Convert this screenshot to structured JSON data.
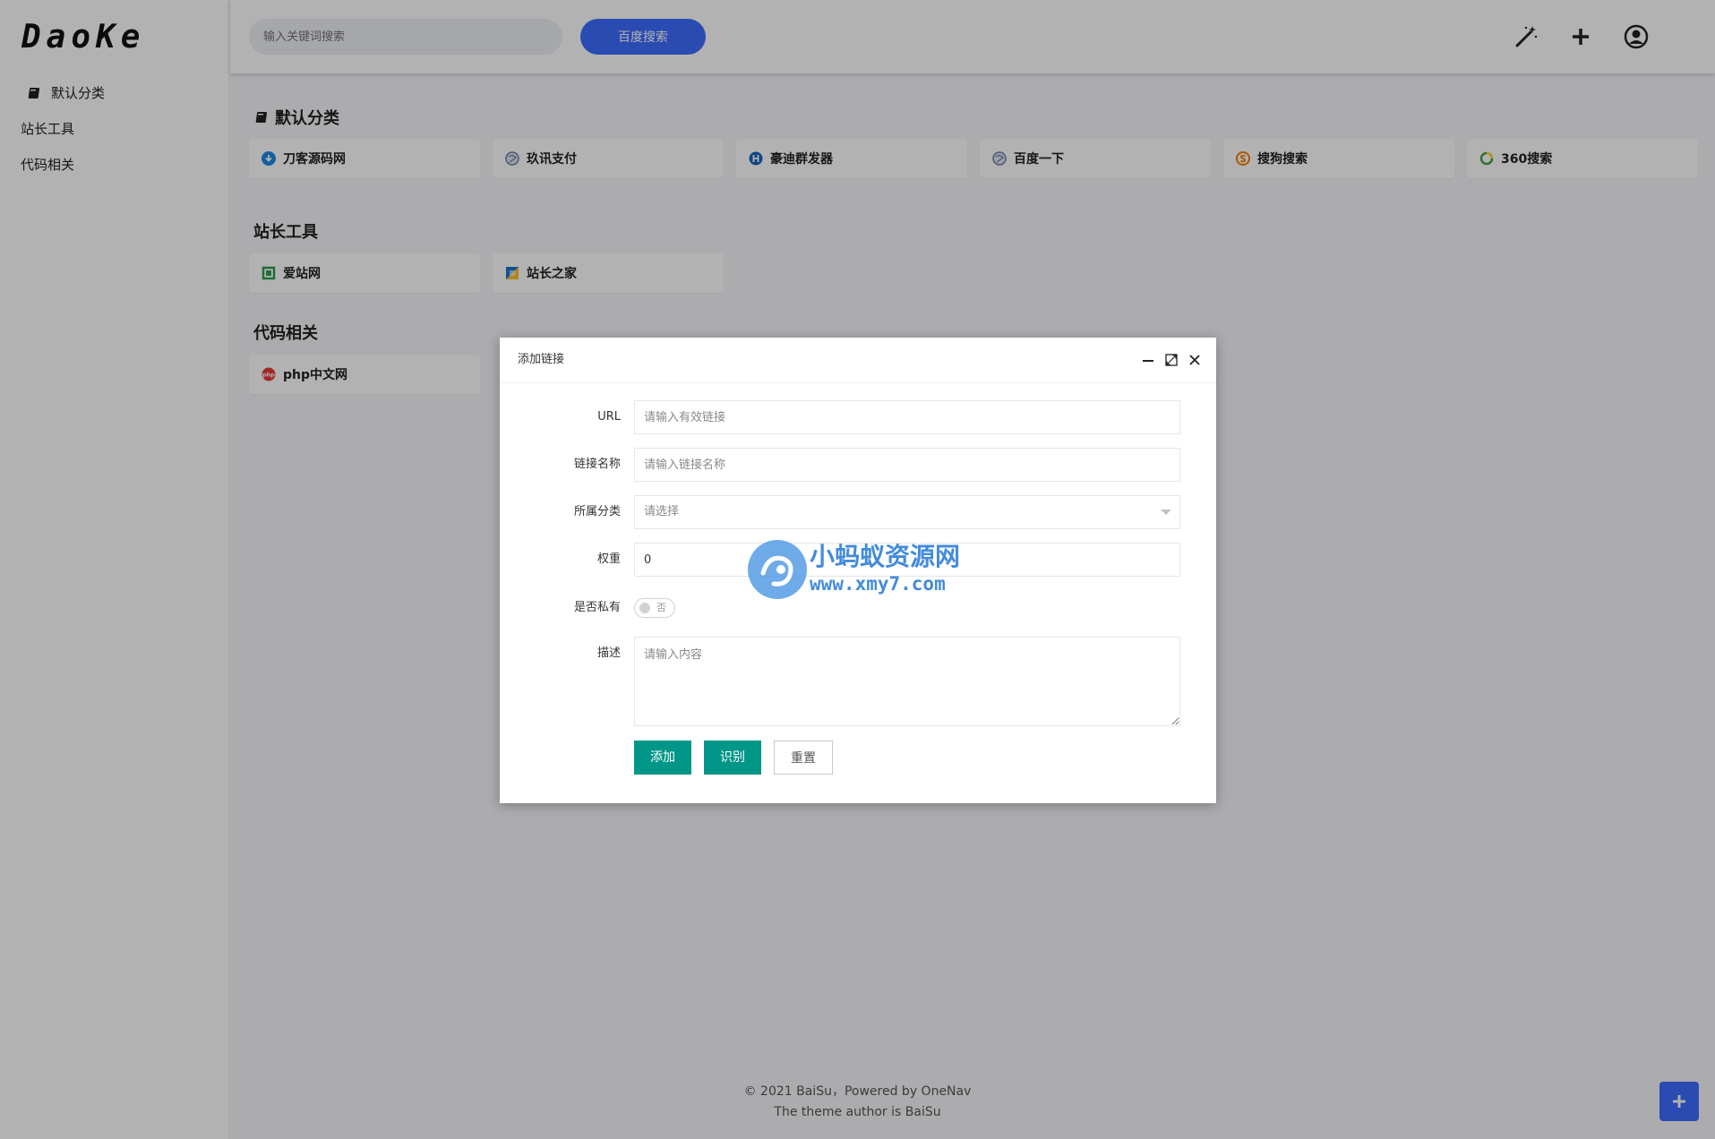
{
  "sidebar": {
    "logo": "DaoKe",
    "items": [
      {
        "label": "默认分类",
        "icon": "book-icon"
      },
      {
        "label": "站长工具"
      },
      {
        "label": "代码相关"
      }
    ]
  },
  "header": {
    "search_placeholder": "输入关键词搜索",
    "search_button": "百度搜索",
    "icons": [
      "magic-wand-icon",
      "plus-icon",
      "user-circle-icon"
    ]
  },
  "categories": [
    {
      "title": "默认分类",
      "links": [
        {
          "label": "刀客源码网",
          "icon": "cloud-download-icon",
          "color": "#1e88e5"
        },
        {
          "label": "玖讯支付",
          "icon": "globe-icon",
          "color": "#6b7fa8"
        },
        {
          "label": "豪迪群发器",
          "icon": "h-badge-icon",
          "color": "#1565c0"
        },
        {
          "label": "百度一下",
          "icon": "globe-icon",
          "color": "#6b7fa8"
        },
        {
          "label": "搜狗搜索",
          "icon": "sogou-icon",
          "color": "#f57c00"
        },
        {
          "label": "360搜索",
          "icon": "360-icon",
          "color": "#43a047"
        }
      ]
    },
    {
      "title": "站长工具",
      "links": [
        {
          "label": "爱站网",
          "icon": "aizhan-icon",
          "color": "#2e9e4f"
        },
        {
          "label": "站长之家",
          "icon": "chinaz-icon",
          "color": "#1976d2"
        }
      ]
    },
    {
      "title": "代码相关",
      "links": [
        {
          "label": "php中文网",
          "icon": "php-icon",
          "color": "#e53935"
        }
      ]
    }
  ],
  "footer": {
    "line1": "© 2021 BaiSu，Powered by OneNav",
    "line2": "The theme author is BaiSu"
  },
  "modal": {
    "title": "添加链接",
    "fields": {
      "url": {
        "label": "URL",
        "placeholder": "请输入有效链接"
      },
      "name": {
        "label": "链接名称",
        "placeholder": "请输入链接名称"
      },
      "category": {
        "label": "所属分类",
        "value": "请选择"
      },
      "weight": {
        "label": "权重",
        "value": "0"
      },
      "private": {
        "label": "是否私有",
        "state": "否"
      },
      "description": {
        "label": "描述",
        "placeholder": "请输入内容"
      }
    },
    "buttons": {
      "add": "添加",
      "recognize": "识别",
      "reset": "重置"
    }
  },
  "watermark": {
    "title": "小蚂蚁资源网",
    "url": "www.xmy7.com"
  },
  "colors": {
    "accent": "#3d6cff",
    "primary_button": "#009688"
  }
}
